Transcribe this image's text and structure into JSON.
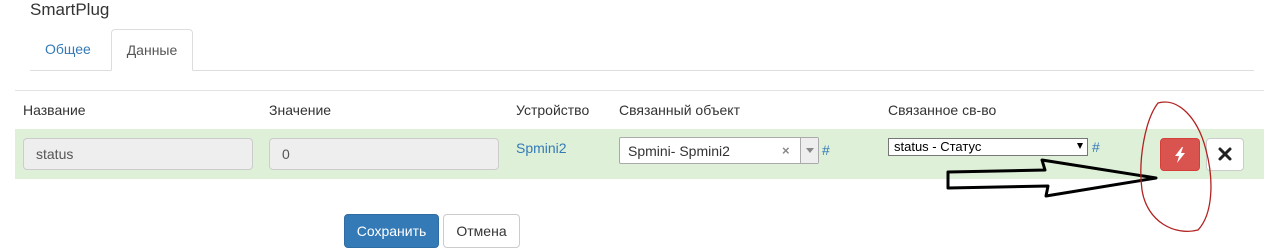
{
  "app": {
    "title": "SmartPlug"
  },
  "tabs": [
    {
      "label": "Общее",
      "active": false
    },
    {
      "label": "Данные",
      "active": true
    }
  ],
  "table": {
    "headers": [
      "Название",
      "Значение",
      "Устройство",
      "Связанный объект",
      "Связанное св-во"
    ],
    "row": {
      "name": "status",
      "value": "0",
      "device": "Spmini2",
      "linked_object": {
        "value": "Spmini- Spmini2",
        "clear": "×",
        "hash": "#"
      },
      "linked_property": {
        "value": "status - Статус",
        "hash": "#"
      }
    }
  },
  "actions": {
    "save": "Сохранить",
    "cancel": "Отмена"
  },
  "colors": {
    "accent": "#337ab7",
    "row_success": "#dff0d8",
    "danger": "#d9534f",
    "annotation_circle": "#b22222"
  },
  "icons": {
    "run_button": "bolt-icon",
    "delete_button": "close-icon"
  }
}
